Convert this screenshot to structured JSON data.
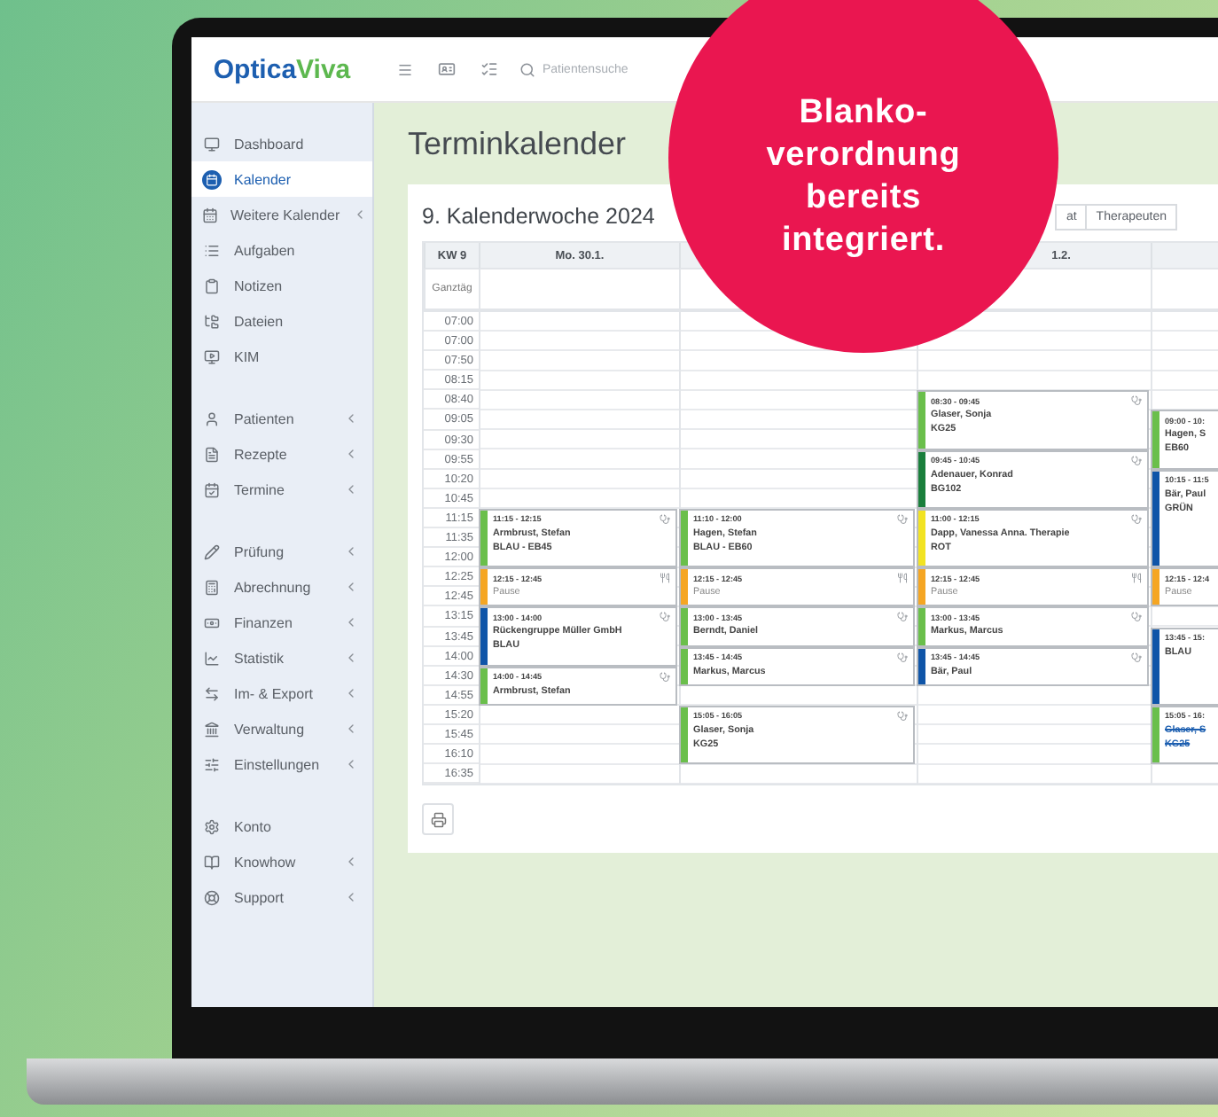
{
  "logo": {
    "part1": "Optica",
    "part2": "Viva"
  },
  "search": {
    "placeholder": "Patientensuche"
  },
  "sidebar": {
    "groups": [
      {
        "items": [
          {
            "label": "Dashboard",
            "selected": false,
            "expandable": false
          },
          {
            "label": "Kalender",
            "selected": true,
            "expandable": false
          },
          {
            "label": "Weitere Kalender",
            "selected": false,
            "expandable": true
          },
          {
            "label": "Aufgaben",
            "selected": false,
            "expandable": false
          },
          {
            "label": "Notizen",
            "selected": false,
            "expandable": false
          },
          {
            "label": "Dateien",
            "selected": false,
            "expandable": false
          },
          {
            "label": "KIM",
            "selected": false,
            "expandable": false
          }
        ]
      },
      {
        "items": [
          {
            "label": "Patienten",
            "selected": false,
            "expandable": true
          },
          {
            "label": "Rezepte",
            "selected": false,
            "expandable": true
          },
          {
            "label": "Termine",
            "selected": false,
            "expandable": true
          }
        ]
      },
      {
        "items": [
          {
            "label": "Prüfung",
            "selected": false,
            "expandable": true
          },
          {
            "label": "Abrechnung",
            "selected": false,
            "expandable": true
          },
          {
            "label": "Finanzen",
            "selected": false,
            "expandable": true
          },
          {
            "label": "Statistik",
            "selected": false,
            "expandable": true
          },
          {
            "label": "Im- & Export",
            "selected": false,
            "expandable": true
          },
          {
            "label": "Verwaltung",
            "selected": false,
            "expandable": true
          },
          {
            "label": "Einstellungen",
            "selected": false,
            "expandable": true
          }
        ]
      },
      {
        "items": [
          {
            "label": "Konto",
            "selected": false,
            "expandable": false
          },
          {
            "label": "Knowhow",
            "selected": false,
            "expandable": true
          },
          {
            "label": "Support",
            "selected": false,
            "expandable": true
          }
        ]
      }
    ]
  },
  "page_title": "Terminkalender",
  "calendar": {
    "title": "9. Kalenderwoche 2024",
    "view_buttons": [
      {
        "label": "at",
        "selected": false
      },
      {
        "label": "Therapeuten",
        "selected": false
      }
    ],
    "columns": [
      "KW 9",
      "Mo. 30.1.",
      "",
      "1.2.",
      ""
    ],
    "all_day_label": "Ganztäg",
    "times": [
      "07:00",
      "07:00",
      "07:50",
      "08:15",
      "08:40",
      "09:05",
      "09:30",
      "09:55",
      "10:20",
      "10:45",
      "11:15",
      "11:35",
      "12:00",
      "12:25",
      "12:45",
      "13:15",
      "13:45",
      "14:00",
      "14:30",
      "14:55",
      "15:20",
      "15:45",
      "16:10",
      "16:35"
    ],
    "days": [
      {
        "events": [
          {
            "kind": "appointment",
            "time": "11:15 - 12:15",
            "title": "Armbrust, Stefan",
            "detail": "BLAU - EB45",
            "color": "#6abf4b",
            "cancelled": false
          },
          {
            "kind": "pause",
            "time": "12:15 - 12:45",
            "title": "Pause",
            "color": "#f5a623",
            "cancelled": false
          },
          {
            "kind": "appointment",
            "time": "13:00 - 14:00",
            "title": "Rückengruppe Müller GmbH",
            "detail": "BLAU",
            "color": "#0f55a8",
            "cancelled": false
          },
          {
            "kind": "appointment",
            "time": "14:00 - 14:45",
            "title": "Armbrust, Stefan",
            "color": "#6abf4b",
            "cancelled": false
          }
        ]
      },
      {
        "events": [
          {
            "kind": "appointment",
            "time": "11:10 - 12:00",
            "title": "Hagen, Stefan",
            "detail": "BLAU - EB60",
            "color": "#6abf4b",
            "cancelled": false
          },
          {
            "kind": "pause",
            "time": "12:15 - 12:45",
            "title": "Pause",
            "color": "#f5a623",
            "cancelled": false
          },
          {
            "kind": "appointment",
            "time": "13:00 - 13:45",
            "title": "Berndt, Daniel",
            "color": "#6abf4b",
            "cancelled": false
          },
          {
            "kind": "appointment",
            "time": "13:45 - 14:45",
            "title": "Markus, Marcus",
            "color": "#6abf4b",
            "cancelled": false
          },
          {
            "kind": "appointment",
            "time": "15:05 - 16:05",
            "title": "Glaser, Sonja",
            "detail": "KG25",
            "color": "#6abf4b",
            "cancelled": false
          }
        ]
      },
      {
        "events": [
          {
            "kind": "appointment",
            "time": "08:30 - 09:45",
            "title": "Glaser, Sonja",
            "detail": "KG25",
            "color": "#6abf4b",
            "cancelled": false
          },
          {
            "kind": "appointment",
            "time": "09:45 - 10:45",
            "title": "Adenauer, Konrad",
            "detail": "BG102",
            "color": "#1a7f3c",
            "cancelled": false
          },
          {
            "kind": "appointment",
            "time": "11:00 - 12:15",
            "title": "Dapp, Vanessa Anna. Therapie",
            "detail": "ROT",
            "color": "#f2e322",
            "cancelled": false
          },
          {
            "kind": "pause",
            "time": "12:15 - 12:45",
            "title": "Pause",
            "color": "#f5a623",
            "cancelled": false
          },
          {
            "kind": "appointment",
            "time": "13:00 - 13:45",
            "title": "Markus, Marcus",
            "color": "#6abf4b",
            "cancelled": false
          },
          {
            "kind": "appointment",
            "time": "13:45 - 14:45",
            "title": "Bär, Paul",
            "color": "#0f55a8",
            "cancelled": false
          }
        ]
      },
      {
        "events": [
          {
            "kind": "appointment",
            "time": "09:00 - 10:",
            "title": "Hagen, S",
            "detail": "EB60",
            "color": "#6abf4b",
            "cancelled": false
          },
          {
            "kind": "appointment",
            "time": "10:15 - 11:5",
            "title": "Bär, Paul",
            "detail": "GRÜN",
            "color": "#0f55a8",
            "cancelled": false
          },
          {
            "kind": "pause",
            "time": "12:15 - 12:4",
            "title": "Pause",
            "color": "#f5a623",
            "cancelled": false
          },
          {
            "kind": "appointment",
            "time": "13:45 - 15:",
            "title": "BLAU",
            "color": "#0f55a8",
            "cancelled": false
          },
          {
            "kind": "appointment",
            "time": "15:05 - 16:",
            "title": "Glaser, S",
            "detail": "KG25",
            "color": "#6abf4b",
            "cancelled": true
          }
        ]
      }
    ]
  },
  "promo": {
    "text": "Blanko-\nverordnung\nbereits\nintegriert."
  }
}
